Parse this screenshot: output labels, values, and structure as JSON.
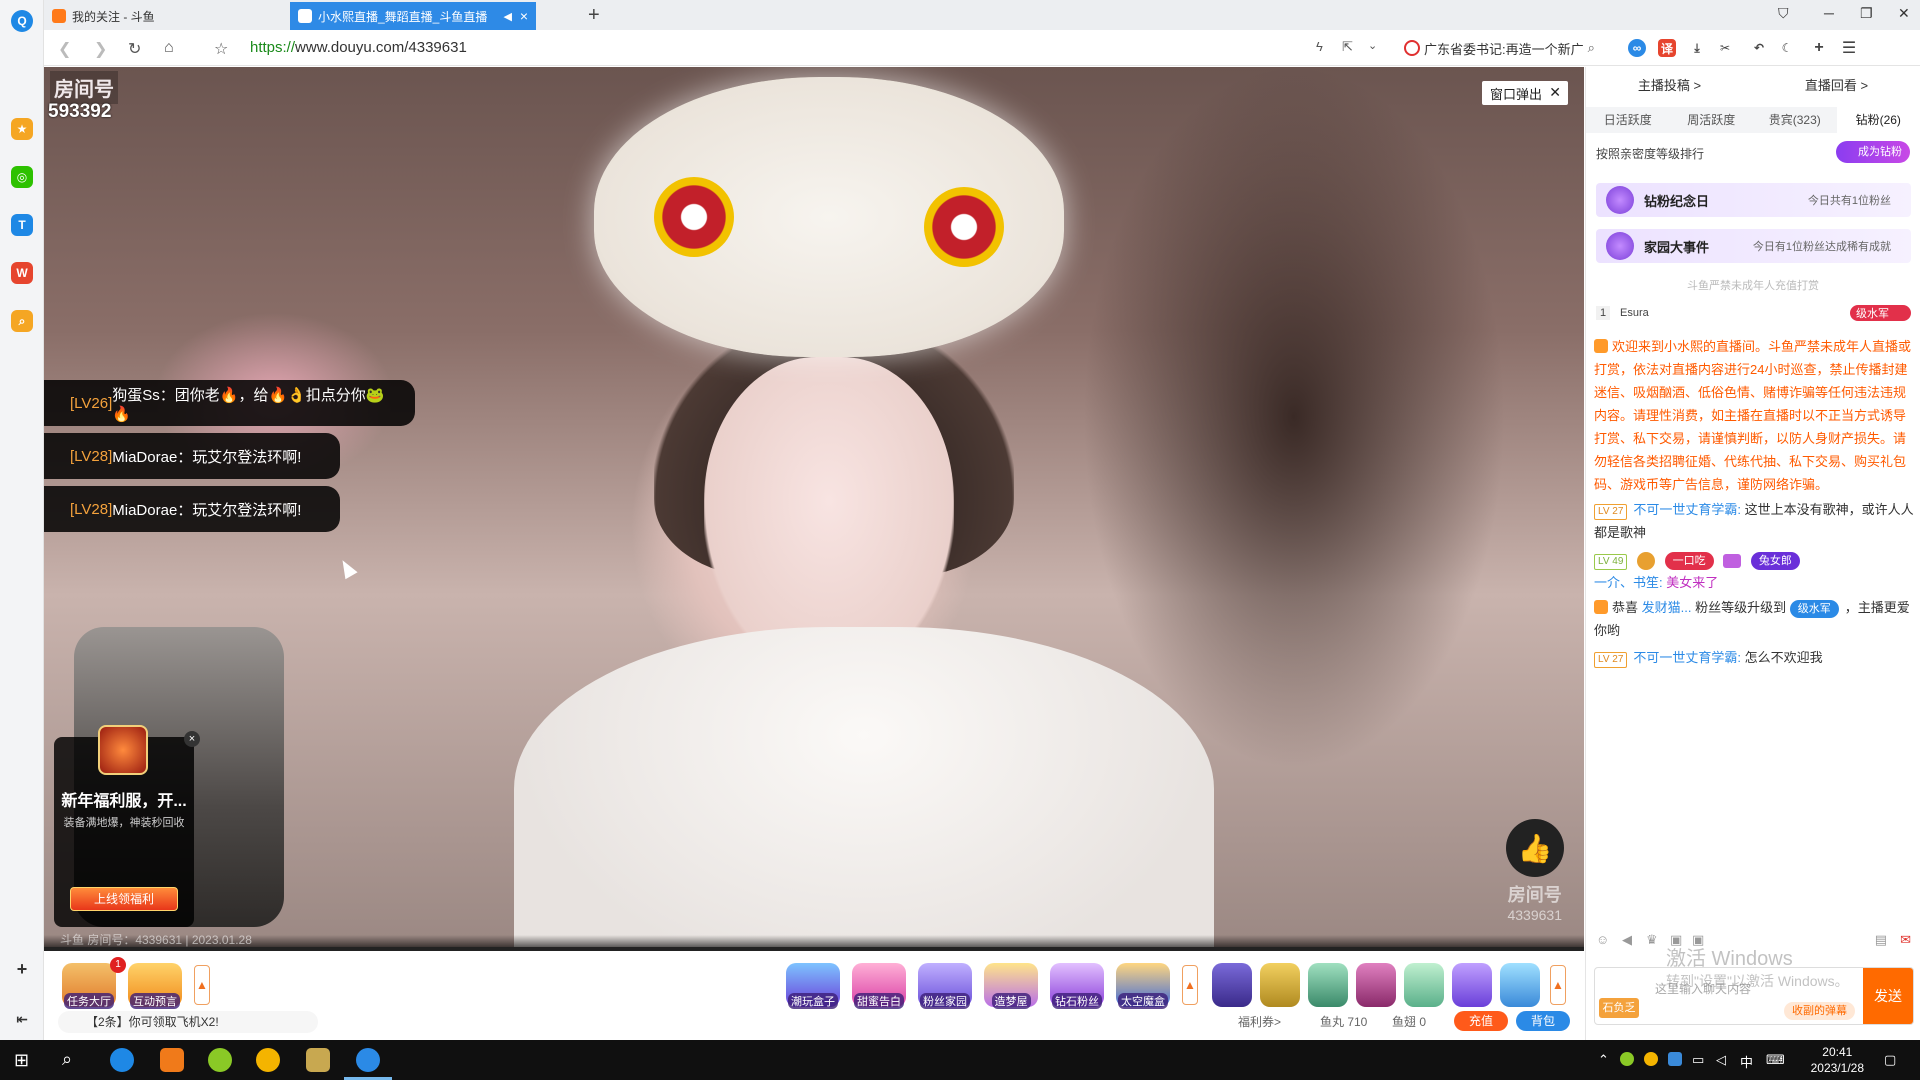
{
  "browser": {
    "tabs": [
      {
        "label": "我的关注 - 斗鱼",
        "active": false
      },
      {
        "label": "小水熙直播_舞蹈直播_斗鱼直播",
        "active": true
      }
    ],
    "url_scheme": "https://",
    "url_rest": "www.douyu.com/4339631",
    "search_text": "广东省委书记:再造一个新广"
  },
  "video": {
    "room_label": "房间号",
    "room_number": "593392",
    "popout_label": "窗口弹出",
    "danmu": [
      {
        "level": "[LV26]",
        "text": "狗蛋Ss：团你老🔥，给🔥👌扣点分你🐸🔥"
      },
      {
        "level": "[LV28]",
        "text": "MiaDorae：玩艾尔登法环啊!"
      },
      {
        "level": "[LV28]",
        "text": "MiaDorae：玩艾尔登法环啊!"
      }
    ],
    "promo": {
      "title": "新年福利服，开...",
      "desc": "装备满地爆，神装秒回收",
      "cta": "上线领福利"
    },
    "watermark_label": "房间号",
    "watermark_number": "4339631",
    "footer_info": "斗鱼 房间号：4339631 | 2023.01.28"
  },
  "toolbar": {
    "left_buttons": [
      {
        "label": "任务大厅",
        "badge": "1"
      },
      {
        "label": "互动预言"
      }
    ],
    "notice": "【2条】你可领取飞机X2!",
    "gifts": [
      "潮玩盒子",
      "甜蜜告白",
      "粉丝家园",
      "造梦屋",
      "钻石粉丝",
      "太空魔盒"
    ],
    "welfare": "福利券>",
    "fish_balls": "鱼丸 710",
    "fish_wings": "鱼翅 0",
    "charge_label": "充值",
    "backpack_label": "背包"
  },
  "sidebar": {
    "top_links": [
      "主播投稿 >",
      "直播回看 >"
    ],
    "rank_tabs": [
      "日活跃度",
      "周活跃度",
      "贵宾(323)",
      "钻粉(26)"
    ],
    "rank_label": "按照亲密度等级排行",
    "become_fan": "成为钻粉",
    "cards": [
      {
        "title": "钻粉纪念日",
        "sub": "今日共有1位粉丝"
      },
      {
        "title": "家园大事件",
        "sub": "今日有1位粉丝达成稀有成就"
      }
    ],
    "minor_note": "斗鱼严禁未成年人充值打赏",
    "rank_row": {
      "num": "1",
      "name": "Esura",
      "badge": "级水军"
    },
    "chat": {
      "system_msg": "欢迎来到小水熙的直播间。斗鱼严禁未成年人直播或打赏，依法对直播内容进行24小时巡查，禁止传播封建迷信、吸烟酗酒、低俗色情、赌博诈骗等任何违法违规内容。请理性消费，如主播在直播时以不正当方式诱导打赏、私下交易，请谨慎判断，以防人身财产损失。请勿轻信各类招聘征婚、代练代抽、私下交易、购买礼包码、游戏币等广告信息，谨防网络诈骗。",
      "msg1": {
        "lv": "LV 27",
        "user": "不可一世丈育学霸:",
        "text": "这世上本没有歌神，或许人人都是歌神"
      },
      "msg2": {
        "lv": "LV 49",
        "pill1": "一口吃",
        "pill2": "兔女郎",
        "user": "一介、书笙:",
        "text": "美女来了"
      },
      "msg3": {
        "pre": "恭喜",
        "user": "发财猫...",
        "mid": "粉丝等级升级到",
        "badge": "级水军",
        "post": "，主播更爱你哟"
      },
      "msg4": {
        "lv": "LV 27",
        "user": "不可一世丈育学霸:",
        "text": "怎么不欢迎我"
      }
    },
    "input_placeholder": "这里输入聊天内容",
    "input_mode": "石负乏",
    "input_toggle": "收副的弹幕",
    "send_label": "发送",
    "activate_title": "激活 Windows",
    "activate_sub": "转到\"设置\"以激活 Windows。"
  },
  "taskbar": {
    "time": "20:41",
    "date": "2023/1/28",
    "ime": "中"
  }
}
